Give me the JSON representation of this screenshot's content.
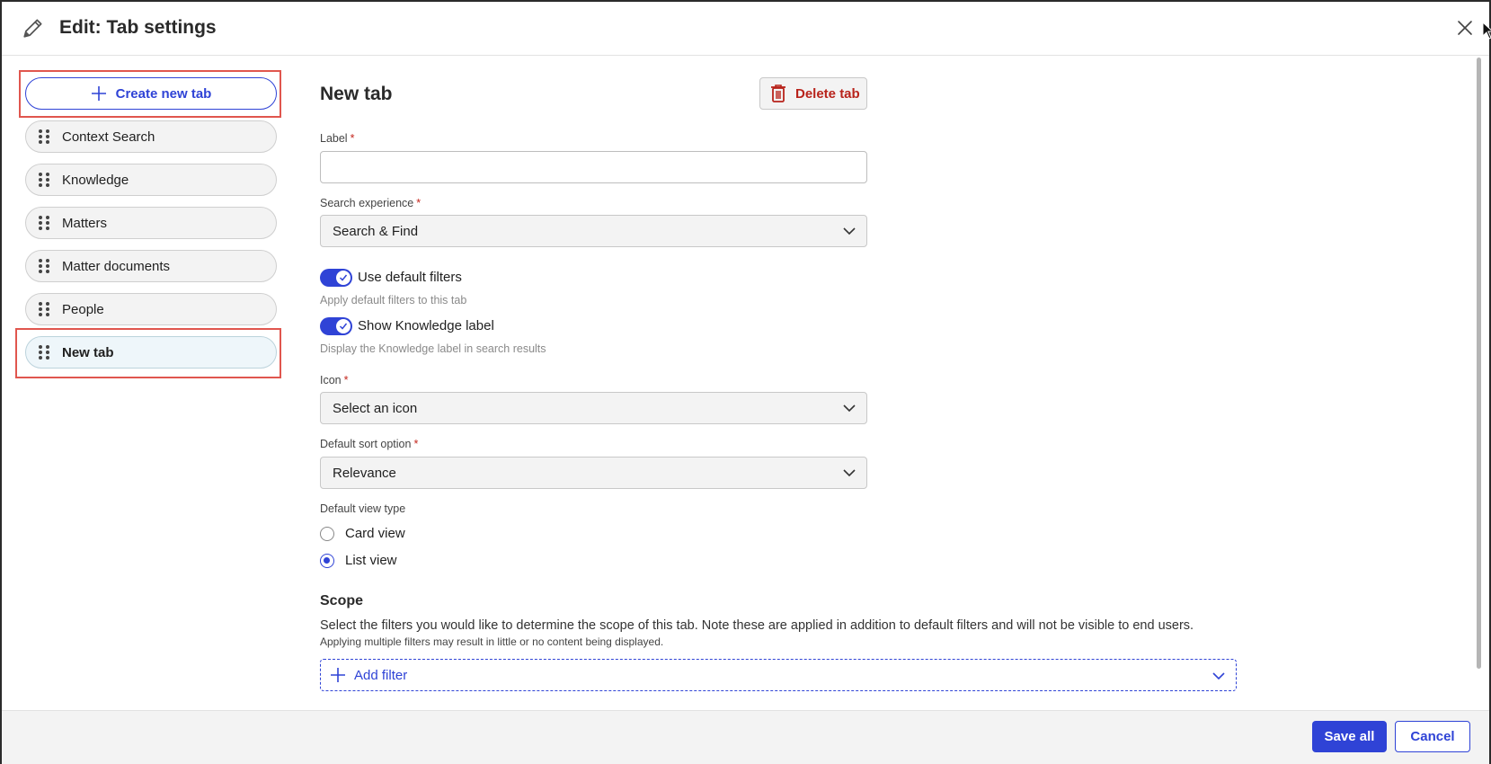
{
  "dialog": {
    "title": "Edit: Tab settings"
  },
  "sidebar": {
    "create_label": "Create new tab",
    "items": [
      {
        "label": "Context Search",
        "active": false
      },
      {
        "label": "Knowledge",
        "active": false
      },
      {
        "label": "Matters",
        "active": false
      },
      {
        "label": "Matter documents",
        "active": false
      },
      {
        "label": "People",
        "active": false
      },
      {
        "label": "New tab",
        "active": true
      }
    ]
  },
  "form": {
    "heading": "New tab",
    "delete_label": "Delete tab",
    "label_field": {
      "label": "Label",
      "required_mark": "*",
      "value": "",
      "placeholder": ""
    },
    "search_experience": {
      "label": "Search experience",
      "required_mark": "*",
      "selected": "Search & Find"
    },
    "use_default_filters": {
      "label": "Use default filters",
      "checked": true,
      "hint": "Apply default filters to this tab"
    },
    "show_knowledge_label": {
      "label": "Show Knowledge label",
      "checked": true,
      "hint": "Display the Knowledge label in search results"
    },
    "icon": {
      "label": "Icon",
      "required_mark": "*",
      "selected": "Select an icon"
    },
    "default_sort": {
      "label": "Default sort option",
      "required_mark": "*",
      "selected": "Relevance"
    },
    "view_type": {
      "label": "Default view type",
      "options": [
        {
          "label": "Card view",
          "selected": false
        },
        {
          "label": "List view",
          "selected": true
        }
      ]
    },
    "scope": {
      "heading": "Scope",
      "description": "Select the filters you would like to determine the scope of this tab. Note these are applied in addition to default filters and will not be visible to end users.",
      "note": "Applying multiple filters may result in little or no content being displayed.",
      "add_filter_label": "Add filter"
    }
  },
  "footer": {
    "save_label": "Save all",
    "cancel_label": "Cancel"
  },
  "colors": {
    "accent": "#2f43d6",
    "danger": "#b8231b",
    "highlight": "#e0564e"
  },
  "icons": {
    "header": "pencil-icon",
    "close": "close-icon",
    "create": "plus-icon",
    "drag": "drag-grip-icon",
    "delete": "trash-icon",
    "dropdown": "chevron-down-icon",
    "toggle_check": "checkmark-icon"
  }
}
